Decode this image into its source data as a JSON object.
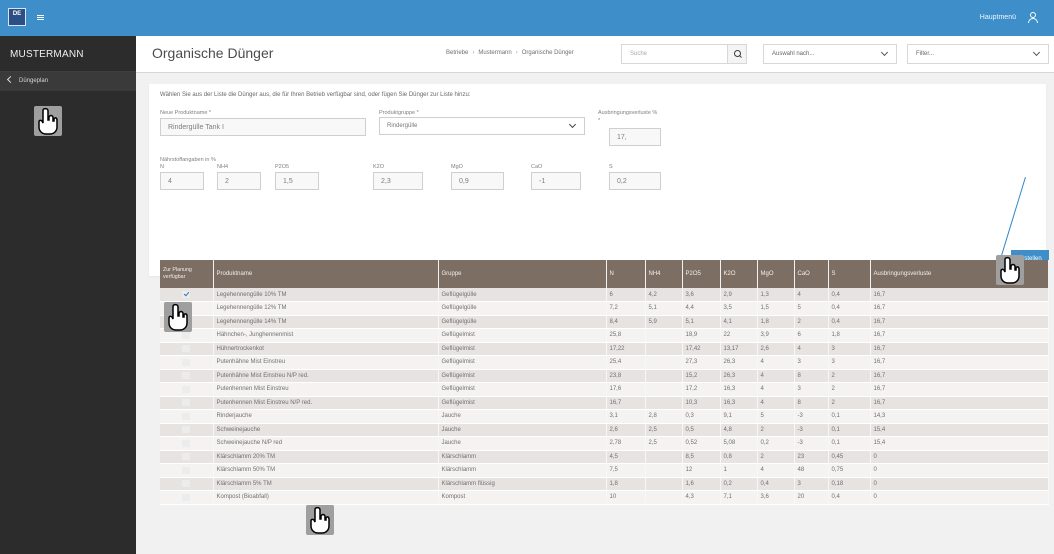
{
  "header": {
    "logo_text": "DE",
    "main_menu": "Hauptmenü"
  },
  "sidebar": {
    "brand": "MUSTERMANN",
    "active_item": "Düngeplan"
  },
  "page": {
    "title": "Organische Dünger",
    "breadcrumb": [
      "Betriebe",
      "Mustermann",
      "Organische Dünger"
    ],
    "search_placeholder": "Suche",
    "select_placeholder": "Auswahl nach...",
    "filter_placeholder": "Filter..."
  },
  "form": {
    "intro": "Wählen Sie aus der Liste die Dünger aus, die für Ihren Betrieb verfügbar sind, oder fügen Sie Dünger zur Liste hinzu:",
    "product_label": "Neue Produktname *",
    "product_value": "Rindergülle Tank I",
    "group_label": "Produktgruppe *",
    "group_value": "Rindergülle",
    "loss_label": "Ausbringungsverluste %",
    "loss_asterisk": "*",
    "loss_value": "17,",
    "nutrient_title": "Nährstoffangaben in %",
    "nutrients": [
      {
        "label": "N",
        "value": "4"
      },
      {
        "label": "NH4",
        "value": "2"
      },
      {
        "label": "P2O5",
        "value": "1,5"
      },
      {
        "label": "K2O",
        "value": "2,3"
      },
      {
        "label": "MgO",
        "value": "0,9"
      },
      {
        "label": "CaO",
        "value": "-1"
      },
      {
        "label": "S",
        "value": "0,2"
      }
    ],
    "create_button": "Erstellen"
  },
  "table": {
    "headers": [
      "Zur Planung verfügbar",
      "Produktname",
      "Gruppe",
      "N",
      "NH4",
      "P2O5",
      "K2O",
      "MgO",
      "CaO",
      "S",
      "Ausbringungsverluste"
    ],
    "rows": [
      {
        "checked": true,
        "cells": [
          "Legehennengülle 10% TM",
          "Geflügelgülle",
          "6",
          "4,2",
          "3,6",
          "2,9",
          "1,3",
          "4",
          "0,4",
          "16,7"
        ]
      },
      {
        "checked": false,
        "cells": [
          "Legehennengülle 12% TM",
          "Geflügelgülle",
          "7,2",
          "5,1",
          "4,4",
          "3,5",
          "1,5",
          "5",
          "0,4",
          "16,7"
        ]
      },
      {
        "checked": false,
        "cells": [
          "Legehennengülle 14% TM",
          "Geflügelgülle",
          "8,4",
          "5,9",
          "5,1",
          "4,1",
          "1,8",
          "2",
          "0,4",
          "16,7"
        ]
      },
      {
        "checked": false,
        "cells": [
          "Hähnchen-, Junghennenmist",
          "Geflügelmist",
          "25,8",
          "",
          "18,9",
          "22",
          "3,9",
          "6",
          "1,8",
          "16,7"
        ]
      },
      {
        "checked": false,
        "cells": [
          "Hühnertrockenkot",
          "Geflügelmist",
          "17,22",
          "",
          "17,42",
          "13,17",
          "2,6",
          "4",
          "3",
          "16,7"
        ]
      },
      {
        "checked": false,
        "cells": [
          "Putenhähne Mist Einstreu",
          "Geflügelmist",
          "25,4",
          "",
          "27,3",
          "26,3",
          "4",
          "3",
          "3",
          "16,7"
        ]
      },
      {
        "checked": false,
        "cells": [
          "Putenhähne Mist Einstreu N/P red.",
          "Geflügelmist",
          "23,8",
          "",
          "15,2",
          "26,3",
          "4",
          "8",
          "2",
          "16,7"
        ]
      },
      {
        "checked": false,
        "cells": [
          "Putenhennen Mist Einstreu",
          "Geflügelmist",
          "17,6",
          "",
          "17,2",
          "16,3",
          "4",
          "3",
          "2",
          "16,7"
        ]
      },
      {
        "checked": false,
        "cells": [
          "Putenhennen Mist Einstreu N/P red.",
          "Geflügelmist",
          "16,7",
          "",
          "10,3",
          "16,3",
          "4",
          "8",
          "2",
          "16,7"
        ]
      },
      {
        "checked": false,
        "cells": [
          "Rinderjauche",
          "Jauche",
          "3,1",
          "2,8",
          "0,3",
          "9,1",
          "5",
          "-3",
          "0,1",
          "14,3"
        ]
      },
      {
        "checked": false,
        "cells": [
          "Schweinejauche",
          "Jauche",
          "2,6",
          "2,5",
          "0,5",
          "4,8",
          "2",
          "-3",
          "0,1",
          "15,4"
        ]
      },
      {
        "checked": false,
        "cells": [
          "Schweinejauche N/P red",
          "Jauche",
          "2,78",
          "2,5",
          "0,52",
          "5,08",
          "0,2",
          "-3",
          "0,1",
          "15,4"
        ]
      },
      {
        "checked": false,
        "cells": [
          "Klärschlamm 20% TM",
          "Klärschlamm",
          "4,5",
          "",
          "8,5",
          "0,8",
          "2",
          "23",
          "0,45",
          "0"
        ]
      },
      {
        "checked": false,
        "cells": [
          "Klärschlamm 50% TM",
          "Klärschlamm",
          "7,5",
          "",
          "12",
          "1",
          "4",
          "48",
          "0,75",
          "0"
        ]
      },
      {
        "checked": false,
        "cells": [
          "Klärschlamm 5% TM",
          "Klärschlamm flüssig",
          "1,8",
          "",
          "1,6",
          "0,2",
          "0,4",
          "3",
          "0,18",
          "0"
        ]
      },
      {
        "checked": false,
        "cells": [
          "Kompost (Bioabfall)",
          "Kompost",
          "10",
          "",
          "4,3",
          "7,1",
          "3,6",
          "20",
          "0,4",
          "0"
        ]
      }
    ]
  }
}
